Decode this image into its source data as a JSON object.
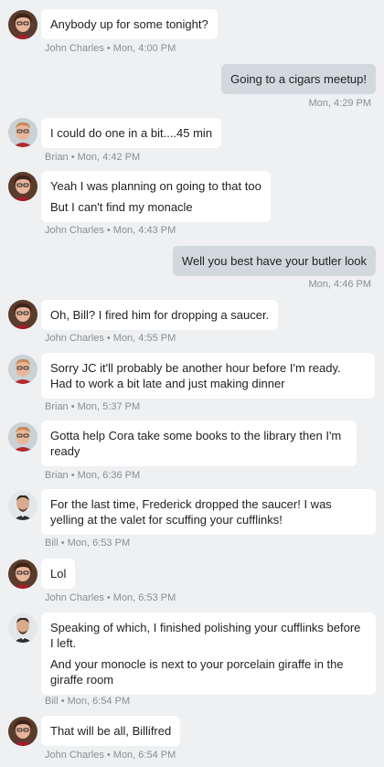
{
  "colors": {
    "background": "#eef0f2",
    "incoming_bubble": "#ffffff",
    "outgoing_bubble": "#d2d9dd",
    "meta_text": "#8a8f94"
  },
  "messages": [
    {
      "direction": "in",
      "avatar": "jc",
      "lines": [
        "Anybody up for some tonight?"
      ],
      "meta": "John Charles • Mon, 4:00 PM"
    },
    {
      "direction": "out",
      "lines": [
        "Going to a cigars meetup!"
      ],
      "meta": "Mon, 4:29 PM"
    },
    {
      "direction": "in",
      "avatar": "brian",
      "lines": [
        "I could do one in a bit....45 min"
      ],
      "meta": "Brian • Mon, 4:42 PM"
    },
    {
      "direction": "in",
      "avatar": "jc",
      "lines": [
        "Yeah I was planning on going to that too",
        "But I can't find my monacle"
      ],
      "meta": "John Charles • Mon, 4:43 PM"
    },
    {
      "direction": "out",
      "lines": [
        "Well you best have your butler look"
      ],
      "meta": "Mon, 4:46 PM"
    },
    {
      "direction": "in",
      "avatar": "jc",
      "lines": [
        "Oh, Bill? I fired him for dropping a saucer."
      ],
      "meta": "John Charles • Mon, 4:55 PM"
    },
    {
      "direction": "in",
      "avatar": "brian",
      "lines": [
        "Sorry JC it'll probably be another hour before I'm ready. Had to work a bit late and just making dinner"
      ],
      "meta": "Brian • Mon, 5:37 PM"
    },
    {
      "direction": "in",
      "avatar": "brian",
      "lines": [
        "Gotta help Cora take some books to the library then I'm ready"
      ],
      "meta": "Brian • Mon, 6:36 PM"
    },
    {
      "direction": "in",
      "avatar": "bill",
      "lines": [
        "For the last time, Frederick dropped the saucer! I was yelling at the valet for scuffing your cufflinks!"
      ],
      "meta": "Bill • Mon, 6:53 PM"
    },
    {
      "direction": "in",
      "avatar": "jc",
      "lines": [
        "Lol"
      ],
      "meta": "John Charles • Mon, 6:53 PM"
    },
    {
      "direction": "in",
      "avatar": "bill",
      "lines": [
        "Speaking of which, I finished polishing your cufflinks before I left.",
        "And your monocle is next to your porcelain giraffe in the giraffe room"
      ],
      "meta": "Bill • Mon, 6:54 PM"
    },
    {
      "direction": "in",
      "avatar": "jc",
      "lines": [
        "That will be all, Billifred"
      ],
      "meta": "John Charles • Mon, 6:54 PM"
    }
  ]
}
